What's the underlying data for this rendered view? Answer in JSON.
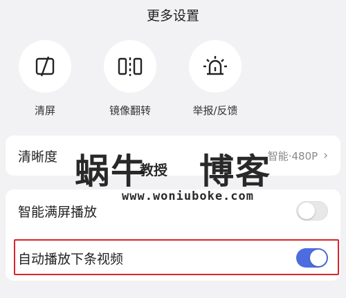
{
  "header": {
    "title": "更多设置"
  },
  "actions": [
    {
      "label": "清屏",
      "icon": "clear-screen-icon"
    },
    {
      "label": "镜像翻转",
      "icon": "mirror-flip-icon"
    },
    {
      "label": "举报/反馈",
      "icon": "report-alarm-icon"
    }
  ],
  "clarity": {
    "label": "清晰度",
    "value": "智能·480P"
  },
  "settings": [
    {
      "label": "智能满屏播放",
      "on": false
    },
    {
      "label": "自动播放下条视频",
      "on": true
    }
  ],
  "watermark": {
    "brand": "蜗牛",
    "middle": "教授",
    "blog": "博客",
    "url": "www.woniuboke.com"
  },
  "colors": {
    "accent": "#4c6ce0",
    "highlight": "#d8232a",
    "background": "#f2f2f4"
  }
}
